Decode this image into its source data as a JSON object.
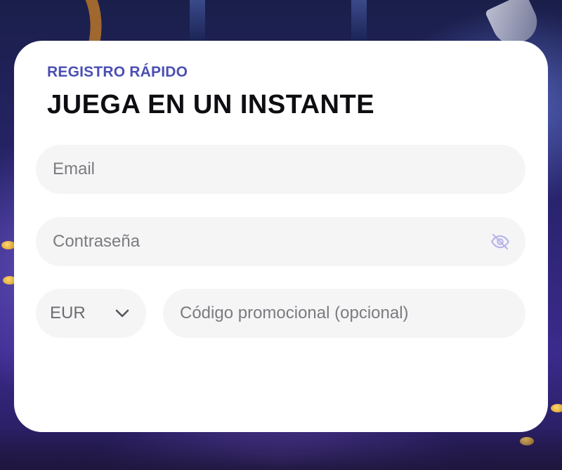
{
  "card": {
    "eyebrow": "REGISTRO RÁPIDO",
    "title": "JUEGA EN UN INSTANTE"
  },
  "form": {
    "email": {
      "value": "",
      "placeholder": "Email"
    },
    "password": {
      "value": "",
      "placeholder": "Contraseña",
      "toggle_icon": "eye-off-icon"
    },
    "currency": {
      "selected": "EUR",
      "icon": "chevron-down-icon"
    },
    "promo_code": {
      "value": "",
      "placeholder": "Código promocional (opcional)"
    }
  },
  "colors": {
    "accent": "#4b4fb3",
    "title": "#0d0d12",
    "field_bg": "#f5f5f6",
    "placeholder": "#7b7b80",
    "icon": "#b7b4ea",
    "card_bg": "#ffffff"
  }
}
